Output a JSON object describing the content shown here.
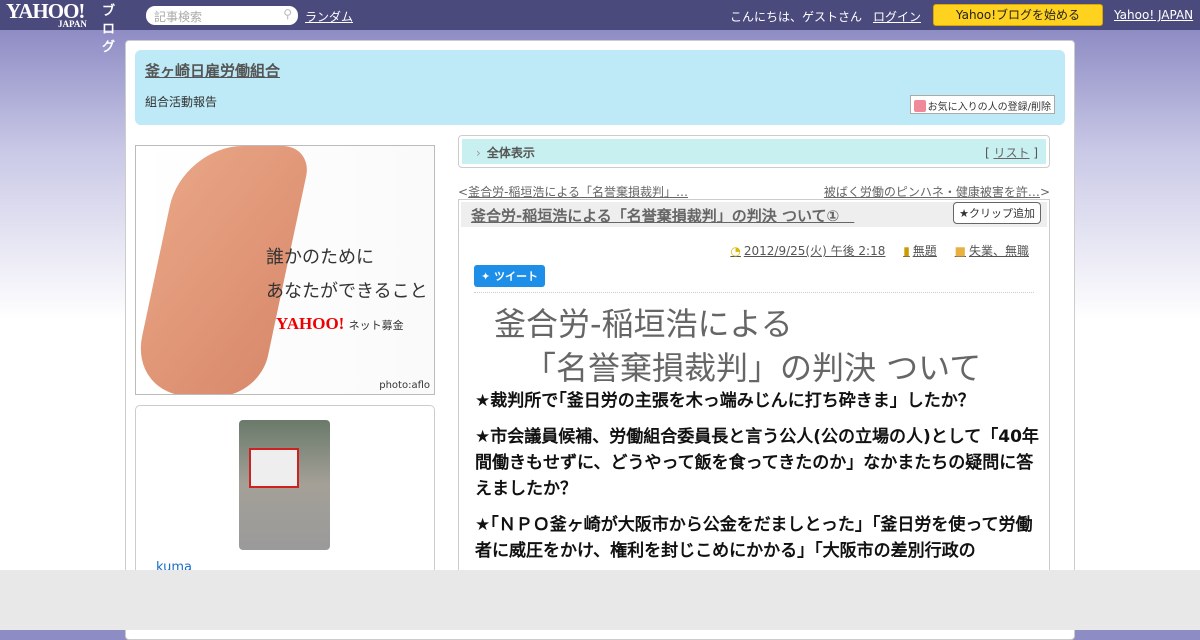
{
  "topbar": {
    "logo": "YAHOO!",
    "logo_sub": "JAPAN",
    "logo_blog": "ブログ",
    "search_placeholder": "記事検索",
    "random": "ランダム",
    "greeting": "こんにちは、ゲストさん",
    "login": "ログイン",
    "start": "Yahoo!ブログを始める",
    "yahoo_japan": "Yahoo! JAPAN"
  },
  "header": {
    "title": "釜ヶ崎日雇労働組合",
    "subtitle": "組合活動報告",
    "favorite": "お気に入りの人の登録/削除"
  },
  "ad": {
    "line1": "誰かのために",
    "line2": "あなたができること",
    "brand": "YAHOO!",
    "brand_sub": "ネット募金",
    "credit": "photo:aflo"
  },
  "profile": {
    "name": "kuma"
  },
  "main": {
    "all_view": "全体表示",
    "list_open": "[ ",
    "list": "リスト",
    "list_close": " ]",
    "prev": "釜合労-稲垣浩による「名誉棄損裁判」…",
    "next": "被ばく労働のピンハネ・健康被害を許…",
    "post": {
      "title": "釜合労-稲垣浩による「名誉棄損裁判」の判決 ついて①　",
      "clip": "クリップ追加",
      "date": "2012/9/25(火) 午後 2:18",
      "theme": "無題",
      "category": "失業、無職",
      "tweet": "ツイート",
      "heading1": "釜合労-稲垣浩による",
      "heading2": "「名誉棄損裁判」の判決 ついて",
      "paragraphs": [
        "★裁判所で｢釜日労の主張を木っ端みじんに打ち砕きま」したか？",
        "★市会議員候補、労働組合委員長と言う公人(公の立場の人)として「40年間働きもせずに、どうやって飯を食ってきたのか」なかまたちの疑問に答えましたか？",
        "★｢ＮＰＯ釜ヶ崎が大阪市から公金をだましとった」｢釜日労を使って労働者に威圧をかけ、権利を封じこめにかかる」｢大阪市の差別行政の"
      ]
    }
  }
}
